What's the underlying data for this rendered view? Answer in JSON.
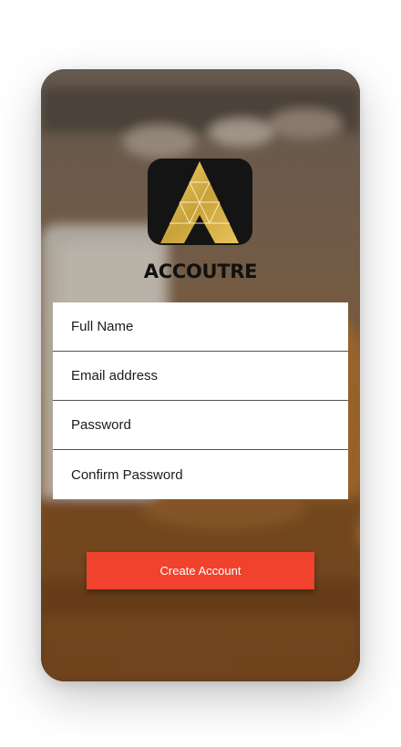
{
  "brand": {
    "name": "ACCOUTRE",
    "logo_icon": "triangle-a-logo-icon"
  },
  "form": {
    "fields": [
      {
        "placeholder": "Full Name"
      },
      {
        "placeholder": "Email address"
      },
      {
        "placeholder": "Password"
      },
      {
        "placeholder": "Confirm Password"
      }
    ],
    "submit_label": "Create Account"
  },
  "colors": {
    "accent": "#f1422d",
    "logo_bg": "#141414",
    "logo_gold": "#d4af37"
  }
}
